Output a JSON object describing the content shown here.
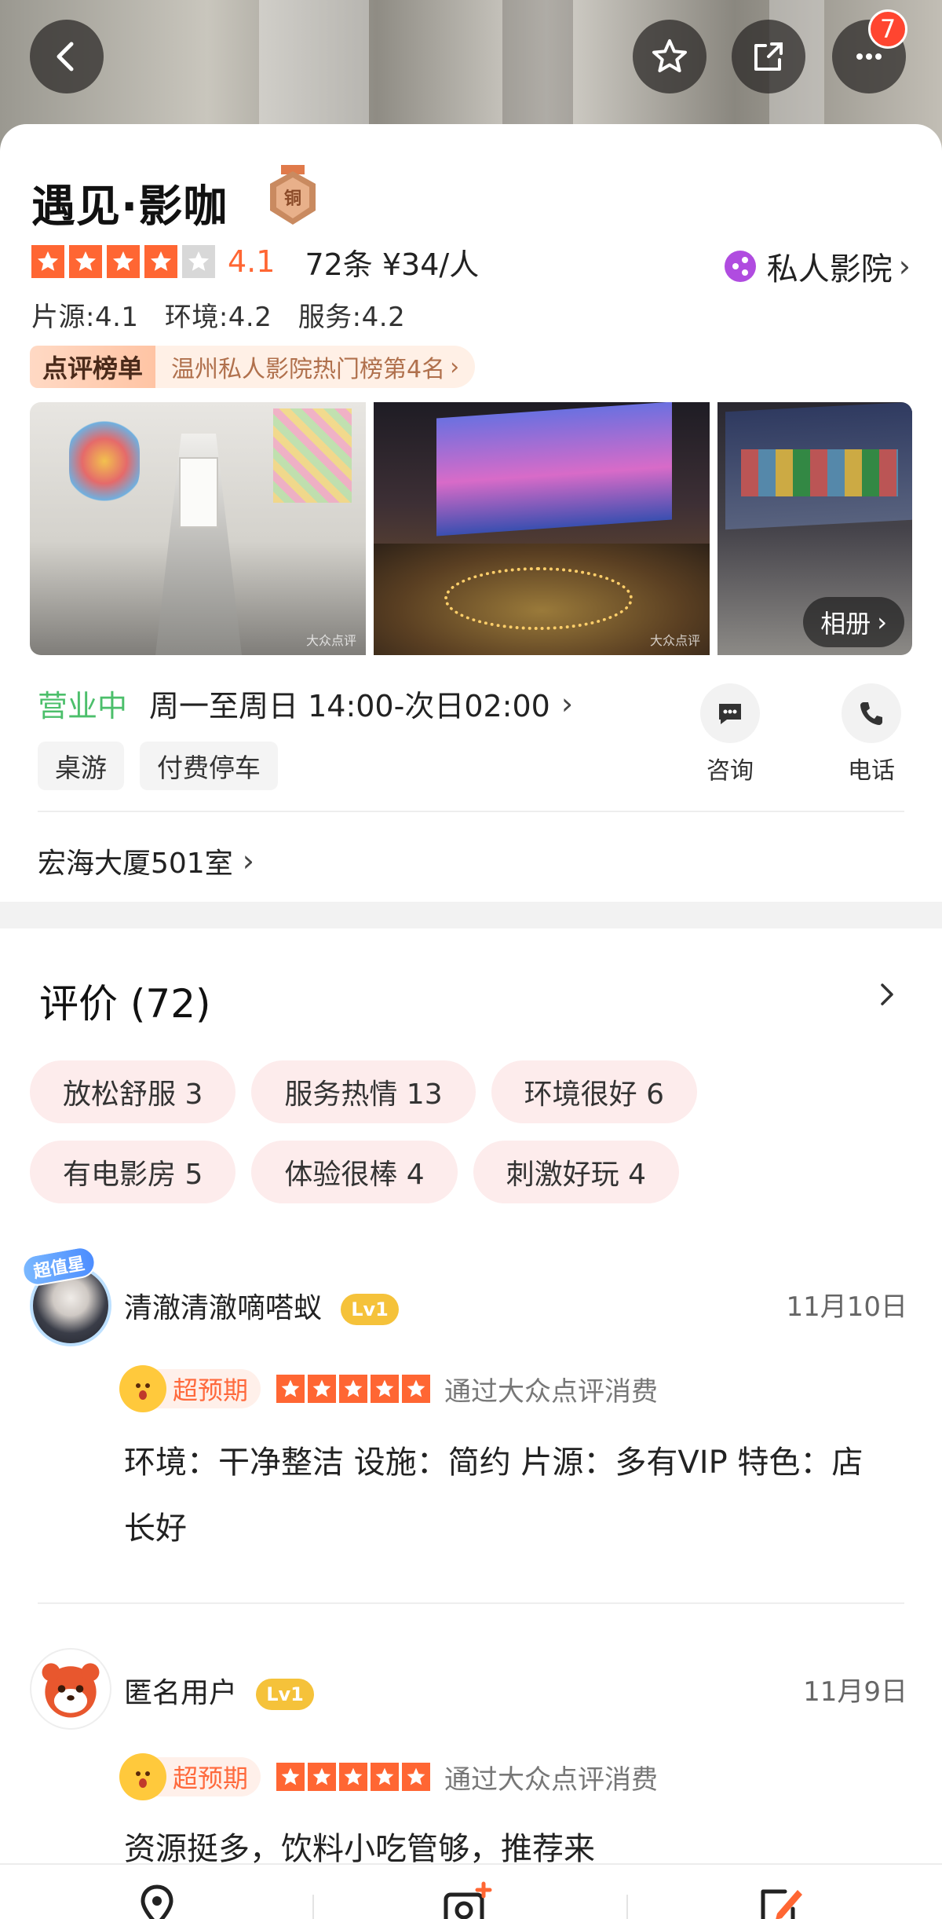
{
  "header": {
    "notification_count": "7",
    "icons": [
      "back-icon",
      "star-outline-icon",
      "share-icon",
      "more-icon"
    ]
  },
  "shop": {
    "name": "遇见·影咖",
    "badge": "铜",
    "rating": "4.1",
    "rating_value": 4.1,
    "stars_max": 5,
    "review_count_price": "72条 ¥34/人",
    "category": "私人影院",
    "scores": [
      "片源:4.1",
      "环境:4.2",
      "服务:4.2"
    ],
    "rank_label": "点评榜单",
    "rank_text": "温州私人影院热门榜第4名",
    "album_label": "相册",
    "photo_watermark": "大众点评",
    "status": "营业中",
    "hours": "周一至周日 14:00-次日02:00",
    "facilities": [
      "桌游",
      "付费停车"
    ],
    "consult_label": "咨询",
    "phone_label": "电话",
    "address": "宏海大厦501室"
  },
  "reviews": {
    "title": "评价 (72)",
    "tags": [
      "放松舒服 3",
      "服务热情 13",
      "环境很好 6",
      "有电影房 5",
      "体验很棒 4",
      "刺激好玩 4"
    ],
    "items": [
      {
        "user": "清澈清澈嘀嗒蚁",
        "level": "Lv1",
        "avatar_badge": "超值星",
        "date": "11月10日",
        "experience": "超预期",
        "stars": 5,
        "via": "通过大众点评消费",
        "text": "环境：干净整洁 设施：简约 片源：多有VIP 特色：店长好"
      },
      {
        "user": "匿名用户",
        "level": "Lv1",
        "date": "11月9日",
        "experience": "超预期",
        "stars": 5,
        "via": "通过大众点评消费",
        "text": "资源挺多，饮料小吃管够，推荐来"
      }
    ]
  },
  "bottom_bar": {
    "icons": [
      "location-pin-icon",
      "camera-add-icon",
      "edit-review-icon"
    ]
  },
  "colors": {
    "accent_orange": "#ff6633",
    "open_green": "#4cbf6b",
    "badge_red": "#ff4530",
    "tag_pink": "#fdecec",
    "level_yellow": "#f5c23a"
  }
}
